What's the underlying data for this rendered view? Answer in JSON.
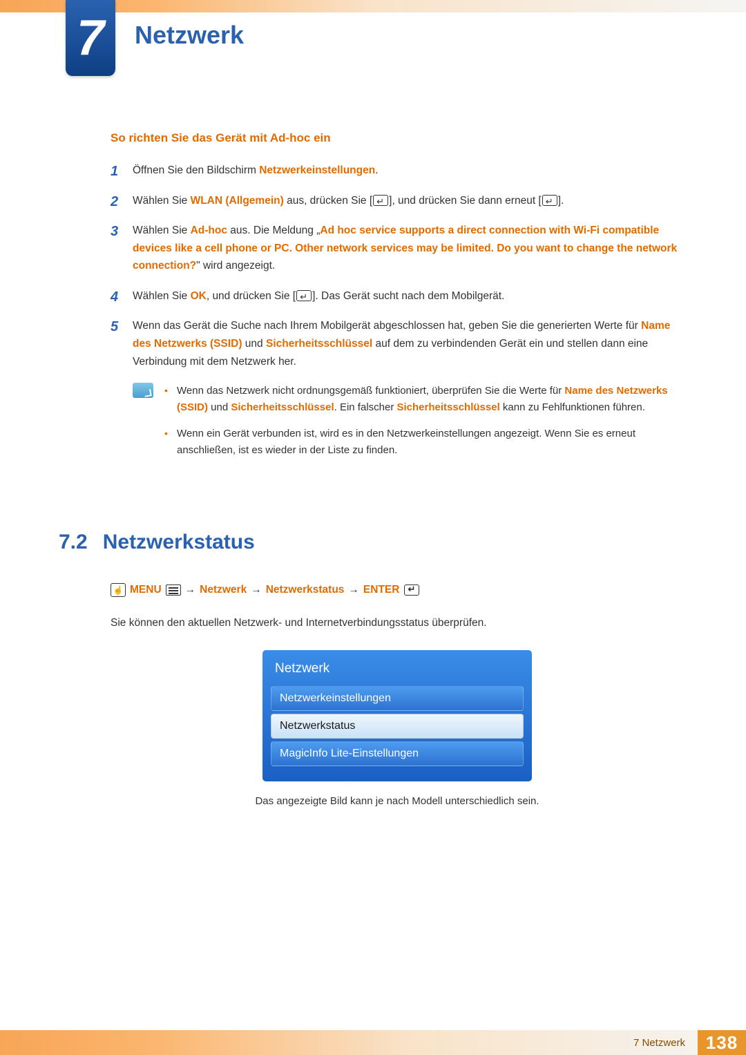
{
  "chapter": {
    "number": "7",
    "title": "Netzwerk"
  },
  "subheading": "So richten Sie das Gerät mit Ad-hoc ein",
  "steps": {
    "s1_a": "Öffnen Sie den Bildschirm ",
    "s1_b": "Netzwerkeinstellungen",
    "s1_c": ".",
    "s2_a": "Wählen Sie ",
    "s2_b": "WLAN (Allgemein)",
    "s2_c": " aus, drücken Sie [",
    "s2_d": "], und drücken Sie dann erneut [",
    "s2_e": "].",
    "s3_a": "Wählen Sie ",
    "s3_b": "Ad-hoc",
    "s3_c": " aus. Die Meldung „",
    "s3_d": "Ad hoc service supports a direct connection with Wi-Fi compatible devices like a cell phone or PC. Other network services may be limited. Do you want to change the network connection?",
    "s3_e": "\" wird angezeigt.",
    "s4_a": "Wählen Sie ",
    "s4_b": "OK",
    "s4_c": ", und drücken Sie [",
    "s4_d": "]. Das Gerät sucht nach dem Mobilgerät.",
    "s5_a": "Wenn das Gerät die Suche nach Ihrem Mobilgerät abgeschlossen hat, geben Sie die generierten Werte für ",
    "s5_b": "Name des Netzwerks (SSID)",
    "s5_c": " und ",
    "s5_d": "Sicherheitsschlüssel",
    "s5_e": " auf dem zu verbindenden Gerät ein und stellen dann eine Verbindung mit dem Netzwerk her."
  },
  "notes": {
    "n1_a": "Wenn das Netzwerk nicht ordnungsgemäß funktioniert, überprüfen Sie die Werte für ",
    "n1_b": "Name des Netzwerks (SSID)",
    "n1_c": " und ",
    "n1_d": "Sicherheitsschlüssel",
    "n1_e": ". Ein falscher ",
    "n1_f": "Sicherheitsschlüssel",
    "n1_g": " kann zu Fehlfunktionen führen.",
    "n2": "Wenn ein Gerät verbunden ist, wird es in den Netzwerkeinstellungen angezeigt. Wenn Sie es erneut anschließen, ist es wieder in der Liste zu finden."
  },
  "section": {
    "num": "7.2",
    "title": "Netzwerkstatus"
  },
  "menupath": {
    "menu": "MENU",
    "p1": "Netzwerk",
    "p2": "Netzwerkstatus",
    "enter": "ENTER"
  },
  "desc": "Sie können den aktuellen Netzwerk- und Internetverbindungsstatus überprüfen.",
  "panel": {
    "title": "Netzwerk",
    "items": [
      "Netzwerkeinstellungen",
      "Netzwerkstatus",
      "MagicInfo Lite-Einstellungen"
    ],
    "selected_index": 1
  },
  "caption": "Das angezeigte Bild kann je nach Modell unterschiedlich sein.",
  "footer": {
    "label": "7 Netzwerk",
    "page": "138"
  }
}
